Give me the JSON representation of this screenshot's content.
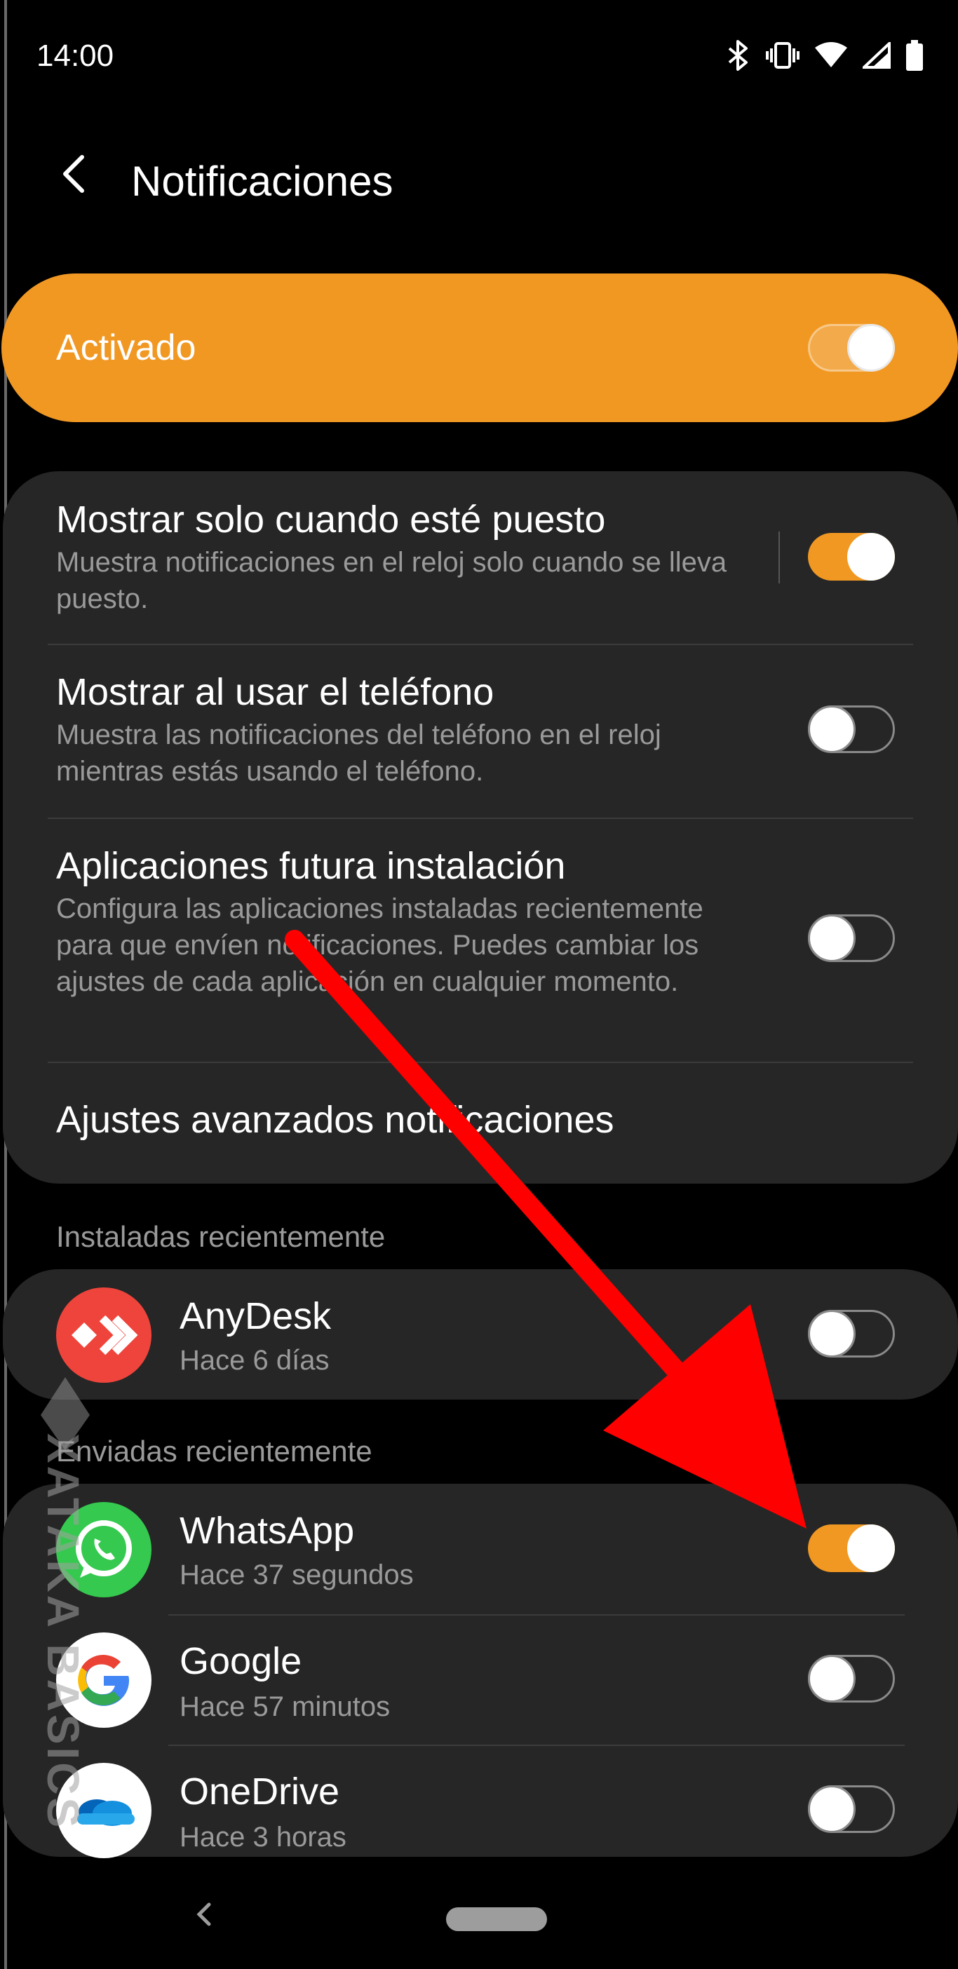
{
  "status_bar": {
    "time": "14:00",
    "icons": [
      "bluetooth-icon",
      "vibrate-icon",
      "wifi-icon",
      "signal-icon",
      "battery-icon"
    ]
  },
  "header": {
    "title": "Notificaciones",
    "back_icon": "chevron-left-icon"
  },
  "master_toggle": {
    "label": "Activado",
    "state": "on"
  },
  "settings": [
    {
      "title": "Mostrar solo cuando esté puesto",
      "subtitle": "Muestra notificaciones en el reloj solo cuando se lleva puesto.",
      "state": "on"
    },
    {
      "title": "Mostrar al usar el teléfono",
      "subtitle": "Muestra las notificaciones del teléfono en el reloj mientras estás usando el teléfono.",
      "state": "off"
    },
    {
      "title": "Aplicaciones futura instalación",
      "subtitle": "Configura las aplicaciones instaladas recientemente para que envíen notificaciones. Puedes cambiar los ajustes de cada aplicación en cualquier momento.",
      "state": "off"
    },
    {
      "title": "Ajustes avanzados notificaciones"
    }
  ],
  "installed_section": {
    "label": "Instaladas recientemente",
    "apps": [
      {
        "name": "AnyDesk",
        "time": "Hace 6 días",
        "icon": "anydesk-icon",
        "state": "off"
      }
    ]
  },
  "sent_section": {
    "label": "Enviadas recientemente",
    "apps": [
      {
        "name": "WhatsApp",
        "time": "Hace 37 segundos",
        "icon": "whatsapp-icon",
        "state": "on"
      },
      {
        "name": "Google",
        "time": "Hace 57 minutos",
        "icon": "google-icon",
        "state": "off"
      },
      {
        "name": "OneDrive",
        "time": "Hace 3 horas",
        "icon": "onedrive-icon",
        "state": "off"
      }
    ]
  },
  "watermark": "XATAKA BASICS",
  "colors": {
    "accent": "#f19823",
    "card": "#262626",
    "background": "#000000",
    "subtext": "#9a9a9a",
    "arrow": "#ff0000"
  }
}
